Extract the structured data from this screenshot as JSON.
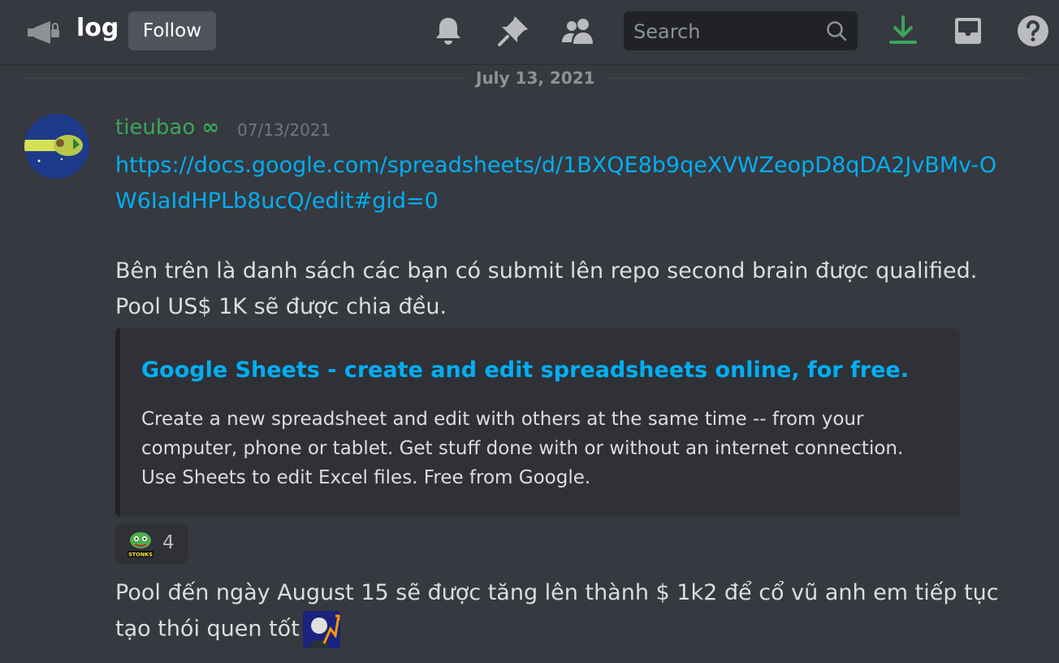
{
  "header": {
    "channel_name": "log",
    "follow_label": "Follow",
    "search_placeholder": "Search",
    "icons": [
      "announcement-channel-icon",
      "bell-icon",
      "pin-icon",
      "members-icon",
      "search-icon",
      "download-icon",
      "inbox-icon",
      "help-icon"
    ]
  },
  "divider": {
    "date": "July 13, 2021"
  },
  "message": {
    "author": "tieubao",
    "author_badge": "∞",
    "timestamp": "07/13/2021",
    "link": "https://docs.google.com/spreadsheets/d/1BXQE8b9qeXVWZeopD8qDA2JvBMv-OW6IaIdHPLb8ucQ/edit#gid=0",
    "text_1": "Bên trên là danh sách các bạn có submit lên repo second brain được qualified. Pool US$ 1K sẽ được chia đều.",
    "embed": {
      "title": "Google Sheets - create and edit spreadsheets online, for free.",
      "description": "Create a new spreadsheet and edit with others at the same time -- from your computer, phone or tablet. Get stuff done with or without an internet connection. Use Sheets to edit Excel files. Free from Google."
    },
    "reaction": {
      "emoji": "stonks-pepe-emoji",
      "emoji_caption": "STONKS",
      "count": "4"
    },
    "text_2": "Pool đến ngày August 15 sẽ được tăng lên thành $ 1k2 để cổ vũ anh em tiếp tục tạo thói quen tốt",
    "inline_emoji": "stonks-man-emoji"
  },
  "colors": {
    "background": "#36393f",
    "link": "#00aff4",
    "author": "#3ba55c",
    "download_accent": "#3ba55c",
    "embed_bg": "#2f3136"
  }
}
